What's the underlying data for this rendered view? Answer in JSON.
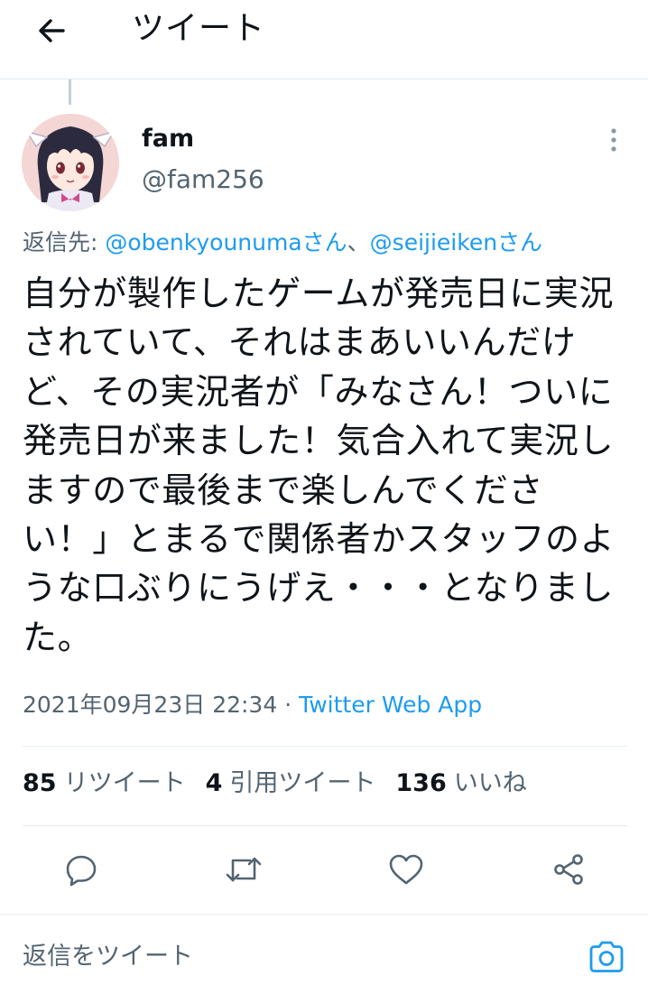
{
  "header": {
    "title": "ツイート",
    "back_icon": "arrow-left-icon"
  },
  "author": {
    "name": "fam",
    "handle": "@fam256"
  },
  "reply": {
    "prefix": "返信先: ",
    "mentions": [
      "@obenkyounumaさん",
      "@seijieikenさん"
    ],
    "separator": "、"
  },
  "tweet": {
    "text": "自分が製作したゲームが発売日に実況されていて、それはまあいいんだけど、その実況者が「みなさん！ついに発売日が来ました！気合入れて実況しますので最後まで楽しんでください！」とまるで関係者かスタッフのような口ぶりにうげえ・・・となりました。",
    "timestamp": "2021年09月23日 22:34",
    "separator": " · ",
    "source": "Twitter Web App"
  },
  "stats": {
    "retweets": {
      "count": "85",
      "label": "リツイート"
    },
    "quotes": {
      "count": "4",
      "label": "引用ツイート"
    },
    "likes": {
      "count": "136",
      "label": "いいね"
    }
  },
  "actions": [
    "reply-icon",
    "retweet-icon",
    "like-icon",
    "share-icon"
  ],
  "compose": {
    "placeholder": "返信をツイート",
    "icon": "camera-icon"
  },
  "colors": {
    "accent": "#1d9bf0",
    "text": "#0f1419",
    "secondary": "#536471",
    "divider": "#e6ecf0"
  }
}
